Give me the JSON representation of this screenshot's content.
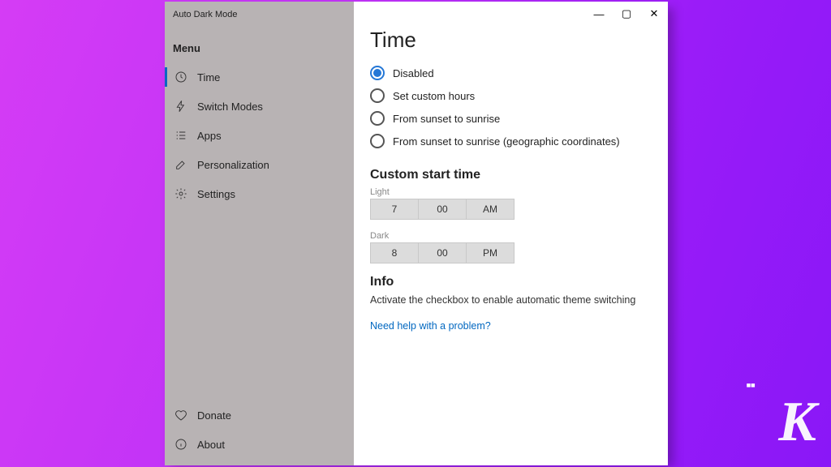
{
  "app": {
    "title": "Auto Dark Mode"
  },
  "window_controls": {
    "min": "—",
    "max": "▢",
    "close": "✕"
  },
  "sidebar": {
    "menu_label": "Menu",
    "items": [
      {
        "label": "Time"
      },
      {
        "label": "Switch Modes"
      },
      {
        "label": "Apps"
      },
      {
        "label": "Personalization"
      },
      {
        "label": "Settings"
      }
    ],
    "bottom": [
      {
        "label": "Donate"
      },
      {
        "label": "About"
      }
    ]
  },
  "page": {
    "title": "Time",
    "options": [
      {
        "label": "Disabled",
        "selected": true
      },
      {
        "label": "Set custom hours",
        "selected": false
      },
      {
        "label": "From sunset to sunrise",
        "selected": false
      },
      {
        "label": "From sunset to sunrise (geographic coordinates)",
        "selected": false
      }
    ],
    "custom_start": {
      "heading": "Custom start time",
      "light_label": "Light",
      "light": {
        "hour": "7",
        "minute": "00",
        "ampm": "AM"
      },
      "dark_label": "Dark",
      "dark": {
        "hour": "8",
        "minute": "00",
        "ampm": "PM"
      }
    },
    "info": {
      "heading": "Info",
      "text": "Activate the checkbox to enable automatic theme switching",
      "help_link": "Need help with a problem?"
    }
  },
  "brand": {
    "letter": "K",
    "dots": "▪▪"
  }
}
